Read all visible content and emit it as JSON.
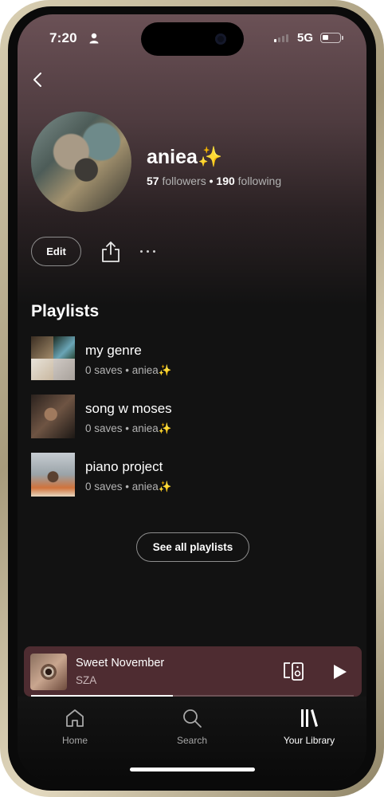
{
  "status_bar": {
    "time": "7:20",
    "network": "5G"
  },
  "profile": {
    "name": "aniea",
    "name_emoji": "✨",
    "followers_count": "57",
    "followers_label": "followers",
    "separator": "•",
    "following_count": "190",
    "following_label": "following"
  },
  "actions": {
    "edit_label": "Edit"
  },
  "playlists_section": {
    "title": "Playlists",
    "items": [
      {
        "title": "my genre",
        "subtitle": "0 saves • aniea",
        "emoji": "✨"
      },
      {
        "title": "song w moses",
        "subtitle": "0 saves • aniea",
        "emoji": "✨"
      },
      {
        "title": "piano project",
        "subtitle": "0 saves • aniea",
        "emoji": "✨"
      }
    ],
    "see_all_label": "See all playlists"
  },
  "now_playing": {
    "title": "Sweet November",
    "artist": "SZA",
    "progress": 0.44
  },
  "tab_bar": {
    "items": [
      {
        "label": "Home",
        "icon": "home-icon",
        "active": false
      },
      {
        "label": "Search",
        "icon": "search-icon",
        "active": false
      },
      {
        "label": "Your Library",
        "icon": "library-icon",
        "active": true
      }
    ]
  },
  "colors": {
    "accent_sparkle": "#f5c518",
    "miniplayer_bg": "#4e2c31",
    "background": "#121212"
  }
}
